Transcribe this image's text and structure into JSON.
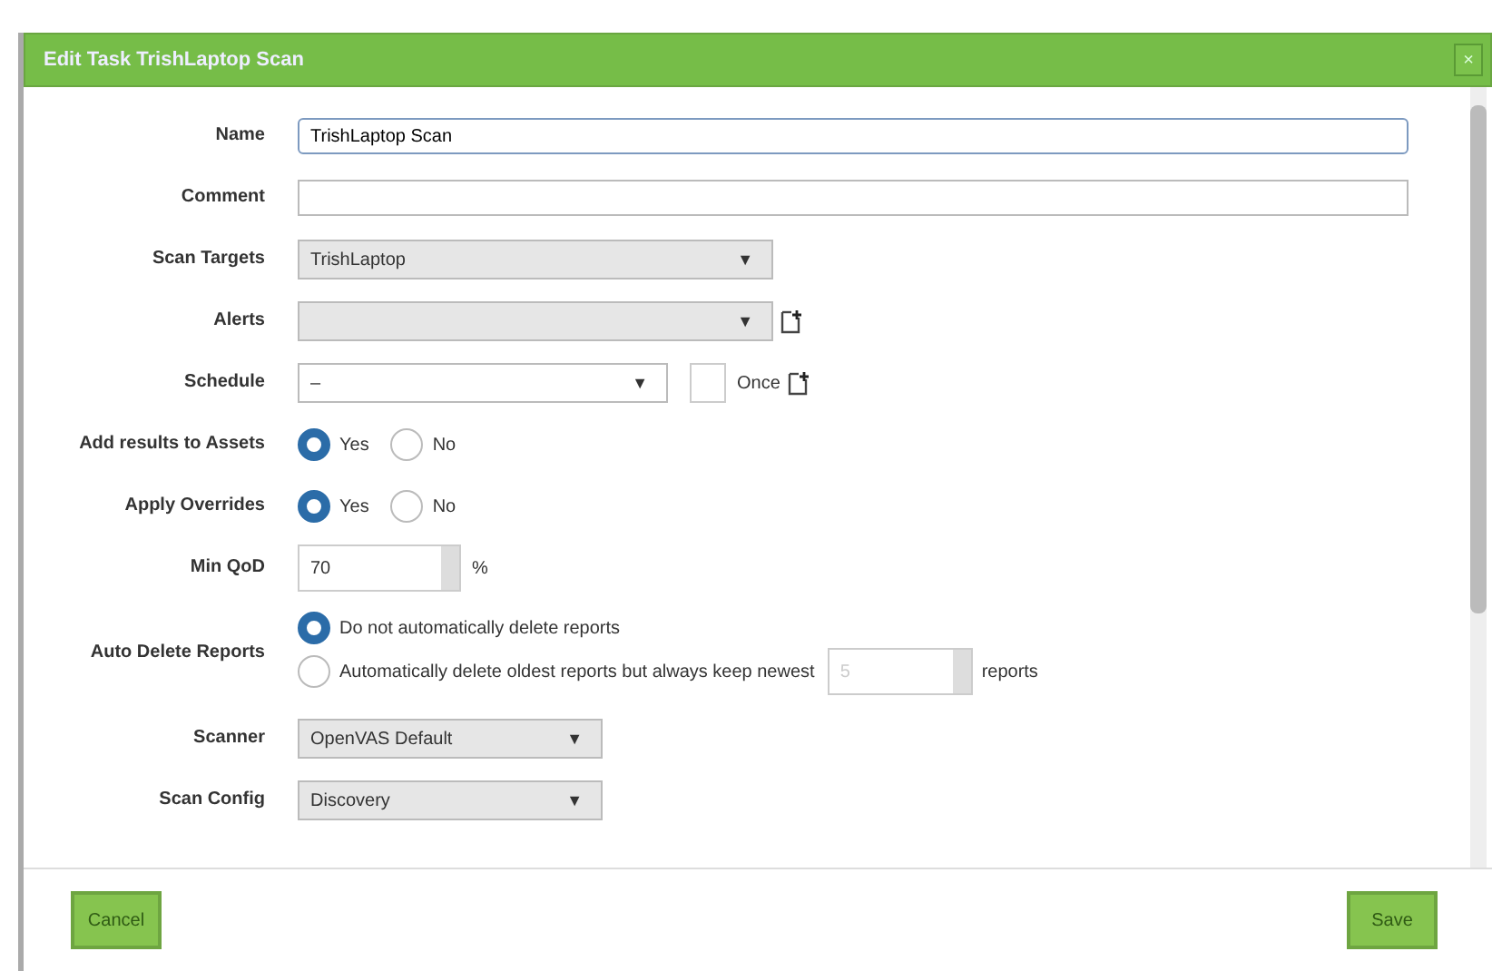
{
  "dialog": {
    "title": "Edit Task TrishLaptop Scan",
    "close": "×"
  },
  "fields": [
    {
      "kind": "text",
      "label": "Name",
      "value": "TrishLaptop Scan"
    },
    {
      "kind": "text",
      "label": "Comment"
    },
    {
      "kind": "select",
      "label": "Scan Targets",
      "value": "TrishLaptop",
      "arrow": "▼"
    },
    {
      "kind": "select",
      "label": "Alerts",
      "arrow": "▼",
      "new_icon": true
    },
    {
      "kind": "select",
      "label": "Schedule",
      "value": "–",
      "arrow": "▼",
      "new_icon": true,
      "once": {
        "checked": false,
        "label": "Once"
      }
    },
    {
      "kind": "radio",
      "label": "Add results to Assets",
      "options": [
        {
          "label": "Yes",
          "selected": true
        },
        {
          "label": "No",
          "selected": false
        }
      ]
    },
    {
      "kind": "radio",
      "label": "Apply Overrides",
      "options": [
        {
          "label": "Yes",
          "selected": true
        },
        {
          "label": "No",
          "selected": false
        }
      ]
    },
    {
      "kind": "spin",
      "label": "Min QoD",
      "value": "70",
      "unit": "%"
    },
    {
      "kind": "autodelete",
      "label": "Auto Delete Reports",
      "options": [
        {
          "label": "Do not automatically delete reports",
          "selected": true
        },
        {
          "label": "Automatically delete oldest reports but always keep newest",
          "selected": false
        }
      ],
      "count": "5",
      "unit": "reports"
    },
    {
      "kind": "select",
      "label": "Scanner",
      "value": "OpenVAS Default",
      "arrow": "▼"
    },
    {
      "kind": "select",
      "label": "Scan Config",
      "value": "Discovery",
      "arrow": "▼"
    }
  ],
  "buttons": [
    {
      "label": "Cancel"
    },
    {
      "label": "Save"
    }
  ]
}
